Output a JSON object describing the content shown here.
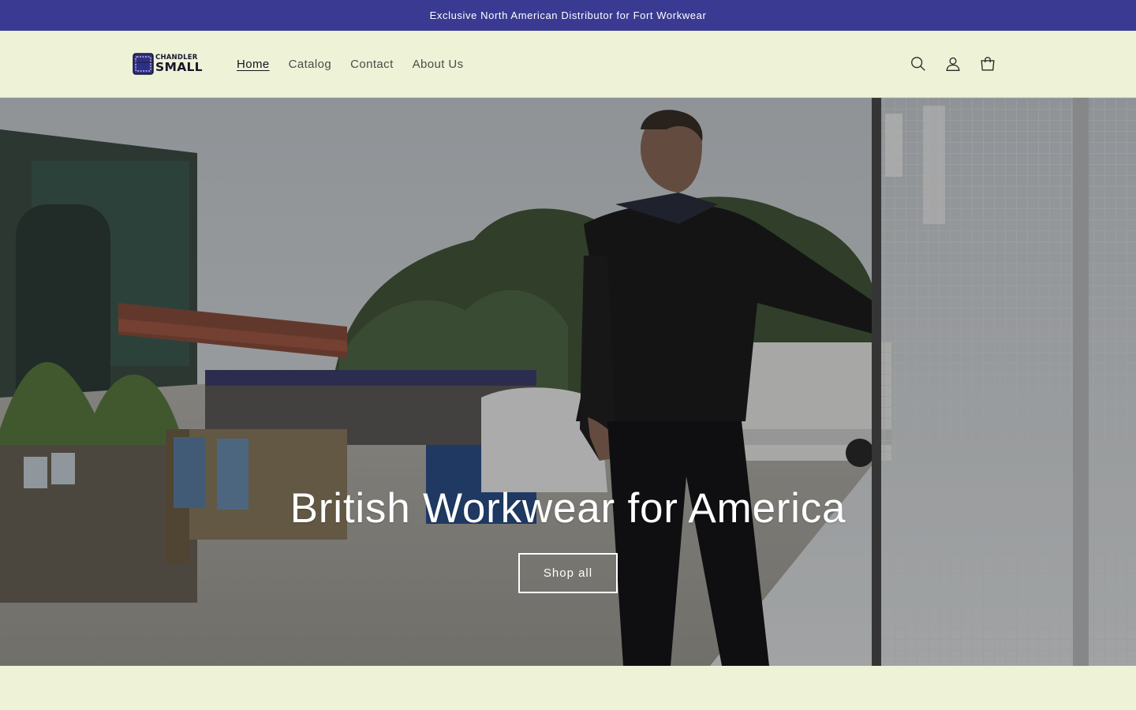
{
  "announcement": {
    "text": "Exclusive North American Distributor for Fort Workwear"
  },
  "header": {
    "logo": {
      "top_text": "CHANDLER",
      "bottom_text": "SMALL"
    },
    "nav": [
      {
        "label": "Home",
        "active": true
      },
      {
        "label": "Catalog",
        "active": false
      },
      {
        "label": "Contact",
        "active": false
      },
      {
        "label": "About Us",
        "active": false
      }
    ],
    "icons": [
      "search-icon",
      "account-icon",
      "cart-icon"
    ]
  },
  "hero": {
    "title": "British Workwear for America",
    "button_label": "Shop all"
  },
  "colors": {
    "announcement_bg": "#3a3a93",
    "page_bg": "#eef3d8",
    "text_dark": "#15151a"
  }
}
